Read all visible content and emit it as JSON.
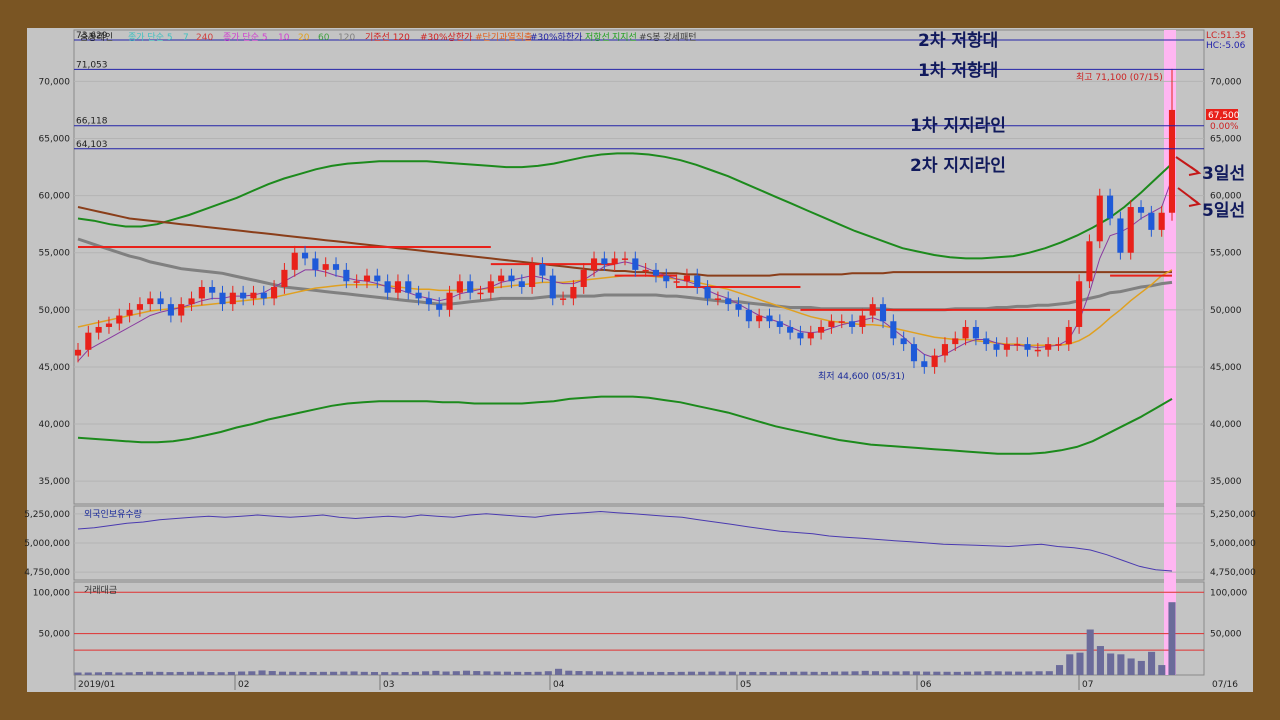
{
  "colors": {
    "background": "#c4c4c4",
    "frame": "#7a5523",
    "up_candle": "#e8211a",
    "down_candle": "#1f5ad8",
    "envelope": "#1c8a1c",
    "ma120": "#8a3e1a",
    "ma60": "#808080",
    "resistance_line": "#2323a8",
    "volume_bar": "#6b6b9a",
    "highlight": "#ffb6f2"
  },
  "header": {
    "title": "숨봉레인",
    "legend": [
      "종가 단순 5",
      "7",
      "240",
      "종가 단순 5",
      "10",
      "20",
      "60",
      "120",
      "기준선 120",
      "#30%상한가",
      "#단기과열직출",
      "#30%하한가",
      "저항선",
      "지지선",
      "#S봉 강세패턴"
    ],
    "lc": "LC:51.35",
    "hc": "HC:-5.06"
  },
  "annotations": {
    "res2": "2차 저항대",
    "res1": "1차 저항대",
    "sup1": "1차 지지라인",
    "sup2": "2차 지지라인",
    "ma3": "3일선",
    "ma5": "5일선"
  },
  "levels": [
    {
      "label": "73,629",
      "value": 73629
    },
    {
      "label": "71,053",
      "value": 71053
    },
    {
      "label": "66,118",
      "value": 66118
    },
    {
      "label": "64,103",
      "value": 64103
    }
  ],
  "markers": {
    "high": "최고 71,100 (07/15)",
    "low": "최저 44,600 (05/31)",
    "current_price": "67,500",
    "current_change": "0.00%"
  },
  "panels": {
    "foreign_label": "외국인보유수량",
    "volume_label": "거래대금"
  },
  "chart_data": {
    "type": "candlestick",
    "x_labels": [
      "2019/01",
      "02",
      "03",
      "04",
      "05",
      "06",
      "07",
      "07/16"
    ],
    "price_ylim": [
      33000,
      74500
    ],
    "price_ticks": [
      {
        "label": "70,000",
        "value": 70000
      },
      {
        "label": "65,000",
        "value": 65000
      },
      {
        "label": "60,000",
        "value": 60000
      },
      {
        "label": "55,000",
        "value": 55000
      },
      {
        "label": "50,000",
        "value": 50000
      },
      {
        "label": "45,000",
        "value": 45000
      },
      {
        "label": "40,000",
        "value": 40000
      },
      {
        "label": "35,000",
        "value": 35000
      }
    ],
    "right_price_ticks": [
      {
        "label": "70,000",
        "value": 70000
      },
      {
        "label": "65,000",
        "value": 65000
      },
      {
        "label": "60,000",
        "value": 60000
      },
      {
        "label": "55,000",
        "value": 55000
      },
      {
        "label": "50,000",
        "value": 50000
      },
      {
        "label": "45,000",
        "value": 45000
      },
      {
        "label": "40,000",
        "value": 40000
      },
      {
        "label": "35,000",
        "value": 35000
      }
    ],
    "close_path": [
      46500,
      48000,
      48500,
      48800,
      49500,
      50000,
      50500,
      51000,
      50500,
      49500,
      50500,
      51000,
      52000,
      51500,
      50500,
      51500,
      51000,
      51500,
      51000,
      52000,
      53500,
      55000,
      54500,
      53500,
      54000,
      53500,
      52500,
      52500,
      53000,
      52500,
      51500,
      52500,
      51500,
      51000,
      50500,
      50000,
      51500,
      52500,
      51500,
      51500,
      52500,
      53000,
      52500,
      52000,
      54000,
      53000,
      51000,
      51000,
      52000,
      53500,
      54500,
      54000,
      54500,
      54500,
      53500,
      53500,
      53000,
      52500,
      52500,
      53000,
      52000,
      51000,
      51000,
      50500,
      50000,
      49000,
      49500,
      49000,
      48500,
      48000,
      47500,
      48000,
      48500,
      49000,
      49000,
      48500,
      49500,
      50500,
      49000,
      47500,
      47000,
      45500,
      45000,
      46000,
      47000,
      47500,
      48500,
      47500,
      47000,
      46500,
      47000,
      47000,
      46500,
      46500,
      47000,
      47000,
      48500,
      52500,
      56000,
      60000,
      58000,
      55000,
      59000,
      58500,
      57000,
      58500,
      67500
    ],
    "ma5_path": [
      45500,
      46500,
      47000,
      47500,
      48000,
      48500,
      49000,
      49500,
      49800,
      50000,
      50200,
      50500,
      50800,
      51000,
      51000,
      51200,
      51200,
      51300,
      51500,
      52000,
      52500,
      53000,
      53500,
      53500,
      53300,
      53000,
      52800,
      52600,
      52500,
      52300,
      52000,
      51800,
      51500,
      51200,
      51000,
      50800,
      51000,
      51400,
      51600,
      51800,
      52000,
      52400,
      52600,
      52800,
      53000,
      52800,
      52500,
      52300,
      52300,
      52600,
      53200,
      53800,
      54000,
      54200,
      54000,
      53700,
      53300,
      53000,
      52700,
      52500,
      52200,
      51700,
      51300,
      51000,
      50500,
      50000,
      49500,
      49200,
      48900,
      48500,
      48100,
      48000,
      48100,
      48400,
      48700,
      48900,
      49100,
      49300,
      49000,
      48300,
      47600,
      46800,
      46100,
      45800,
      46100,
      46600,
      47100,
      47400,
      47400,
      47100,
      46900,
      46900,
      46800,
      46700,
      46800,
      46900,
      47400,
      49000,
      51500,
      54500,
      56500,
      56800,
      57300,
      58000,
      58500,
      59000,
      61500
    ],
    "ma20_path": [
      48500,
      48700,
      48900,
      49100,
      49300,
      49500,
      49700,
      49900,
      50000,
      50100,
      50200,
      50300,
      50400,
      50500,
      50600,
      50700,
      50800,
      50900,
      51000,
      51100,
      51300,
      51500,
      51700,
      51900,
      52000,
      52100,
      52200,
      52200,
      52200,
      52200,
      52100,
      52000,
      51900,
      51800,
      51800,
      51700,
      51700,
      51700,
      51800,
      51800,
      51900,
      52000,
      52100,
      52200,
      52300,
      52400,
      52400,
      52400,
      52500,
      52600,
      52700,
      52800,
      52900,
      53000,
      53000,
      53000,
      52900,
      52800,
      52700,
      52600,
      52400,
      52200,
      52000,
      51800,
      51500,
      51200,
      50900,
      50600,
      50300,
      50000,
      49700,
      49400,
      49200,
      49000,
      48900,
      48800,
      48700,
      48700,
      48600,
      48400,
      48200,
      48000,
      47800,
      47600,
      47500,
      47400,
      47400,
      47300,
      47200,
      47100,
      47000,
      47000,
      46900,
      46900,
      46900,
      46900,
      47000,
      47300,
      47800,
      48500,
      49300,
      50000,
      50800,
      51500,
      52200,
      53000,
      53500
    ],
    "ma60_path": [
      56200,
      55900,
      55600,
      55300,
      55000,
      54700,
      54500,
      54200,
      54000,
      53800,
      53600,
      53500,
      53400,
      53300,
      53200,
      53000,
      52800,
      52600,
      52400,
      52200,
      52000,
      51900,
      51800,
      51700,
      51600,
      51500,
      51400,
      51300,
      51200,
      51100,
      51000,
      50900,
      50800,
      50700,
      50600,
      50500,
      50500,
      50600,
      50700,
      50800,
      50900,
      51000,
      51000,
      51000,
      51000,
      51100,
      51200,
      51200,
      51200,
      51200,
      51200,
      51300,
      51300,
      51300,
      51300,
      51300,
      51300,
      51200,
      51200,
      51100,
      51000,
      50900,
      50800,
      50700,
      50700,
      50600,
      50500,
      50400,
      50300,
      50200,
      50200,
      50200,
      50100,
      50100,
      50100,
      50100,
      50100,
      50100,
      50100,
      50000,
      50000,
      50000,
      50000,
      50000,
      50000,
      50100,
      50100,
      50100,
      50100,
      50200,
      50200,
      50300,
      50300,
      50400,
      50400,
      50500,
      50600,
      50800,
      51000,
      51200,
      51500,
      51600,
      51800,
      52000,
      52100,
      52300,
      52400
    ],
    "ma120_path": [
      59000,
      58800,
      58600,
      58400,
      58200,
      58000,
      57900,
      57800,
      57700,
      57600,
      57500,
      57400,
      57300,
      57200,
      57100,
      57000,
      56900,
      56800,
      56700,
      56600,
      56500,
      56400,
      56300,
      56200,
      56100,
      56000,
      55900,
      55800,
      55700,
      55600,
      55500,
      55400,
      55300,
      55200,
      55100,
      55000,
      54900,
      54800,
      54700,
      54600,
      54500,
      54400,
      54300,
      54200,
      54100,
      54000,
      53900,
      53800,
      53700,
      53600,
      53500,
      53500,
      53400,
      53400,
      53300,
      53300,
      53200,
      53200,
      53200,
      53100,
      53100,
      53000,
      53000,
      53000,
      53000,
      53000,
      53000,
      53000,
      53100,
      53100,
      53100,
      53100,
      53100,
      53100,
      53100,
      53200,
      53200,
      53200,
      53200,
      53300,
      53300,
      53300,
      53300,
      53300,
      53300,
      53300,
      53300,
      53300,
      53300,
      53300,
      53300,
      53300,
      53300,
      53300,
      53300,
      53300,
      53300,
      53300,
      53300,
      53300,
      53300,
      53300,
      53300,
      53300,
      53300,
      53300,
      53300
    ],
    "upper_env": [
      58000,
      57800,
      57500,
      57300,
      57300,
      57500,
      57900,
      58300,
      58800,
      59300,
      59800,
      60400,
      61000,
      61500,
      61900,
      62300,
      62600,
      62800,
      62900,
      63000,
      63000,
      63000,
      63000,
      62900,
      62800,
      62700,
      62600,
      62500,
      62500,
      62600,
      62800,
      63100,
      63400,
      63600,
      63700,
      63700,
      63600,
      63400,
      63100,
      62700,
      62200,
      61700,
      61100,
      60500,
      59900,
      59300,
      58700,
      58100,
      57500,
      56900,
      56400,
      55900,
      55400,
      55100,
      54800,
      54600,
      54500,
      54500,
      54600,
      54700,
      55000,
      55400,
      55900,
      56500,
      57200,
      58000,
      59000,
      60200,
      61500,
      62800
    ],
    "lower_env": [
      38800,
      38700,
      38600,
      38500,
      38400,
      38400,
      38500,
      38700,
      39000,
      39300,
      39700,
      40000,
      40400,
      40700,
      41000,
      41300,
      41600,
      41800,
      41900,
      42000,
      42000,
      42000,
      42000,
      41900,
      41900,
      41800,
      41800,
      41800,
      41800,
      41900,
      42000,
      42200,
      42300,
      42400,
      42400,
      42400,
      42300,
      42100,
      41900,
      41600,
      41300,
      41000,
      40600,
      40200,
      39800,
      39500,
      39200,
      38900,
      38600,
      38400,
      38200,
      38100,
      38000,
      37900,
      37800,
      37700,
      37600,
      37500,
      37400,
      37400,
      37400,
      37500,
      37700,
      38000,
      38500,
      39200,
      39900,
      40600,
      41400,
      42200
    ],
    "support_line_steps": [
      {
        "from": 0,
        "to": 40,
        "value": 55500
      },
      {
        "from": 40,
        "to": 52,
        "value": 54000
      },
      {
        "from": 52,
        "to": 58,
        "value": 53000
      },
      {
        "from": 58,
        "to": 70,
        "value": 52000
      },
      {
        "from": 70,
        "to": 100,
        "value": 50000
      },
      {
        "from": 100,
        "to": 106,
        "value": 53000
      }
    ],
    "foreign_ylim": [
      4700000,
      5300000
    ],
    "foreign_ticks": [
      {
        "label": "5,250,000",
        "value": 5250000
      },
      {
        "label": "5,000,000",
        "value": 5000000
      },
      {
        "label": "4,750,000",
        "value": 4750000
      }
    ],
    "foreign_holdings": [
      5120000,
      5130000,
      5150000,
      5170000,
      5180000,
      5200000,
      5210000,
      5220000,
      5230000,
      5220000,
      5230000,
      5240000,
      5230000,
      5220000,
      5230000,
      5240000,
      5220000,
      5210000,
      5220000,
      5230000,
      5220000,
      5240000,
      5230000,
      5220000,
      5240000,
      5250000,
      5240000,
      5230000,
      5220000,
      5240000,
      5250000,
      5260000,
      5270000,
      5260000,
      5250000,
      5240000,
      5230000,
      5220000,
      5200000,
      5180000,
      5160000,
      5140000,
      5120000,
      5100000,
      5090000,
      5080000,
      5060000,
      5050000,
      5040000,
      5030000,
      5020000,
      5010000,
      5000000,
      4990000,
      4985000,
      4980000,
      4975000,
      4970000,
      4980000,
      4990000,
      4970000,
      4960000,
      4940000,
      4900000,
      4850000,
      4800000,
      4770000,
      4760000
    ],
    "volume_ylim": [
      0,
      110000
    ],
    "volume_ticks": [
      {
        "label": "100,000",
        "value": 100000
      },
      {
        "label": "50,000",
        "value": 50000
      }
    ],
    "volume_hlines": [
      100000,
      50000,
      30000
    ],
    "volume": [
      3000,
      3000,
      3200,
      3500,
      3000,
      3200,
      3600,
      4000,
      3800,
      3500,
      3700,
      3900,
      4000,
      3600,
      3400,
      3700,
      4200,
      4500,
      5500,
      4800,
      4000,
      3900,
      3700,
      3600,
      3800,
      3900,
      4100,
      4300,
      3800,
      3600,
      3500,
      3400,
      3600,
      3800,
      4500,
      5000,
      4200,
      4600,
      5200,
      4800,
      4400,
      4100,
      4000,
      3800,
      3700,
      3900,
      4600,
      7500,
      5200,
      4800,
      4600,
      4400,
      4200,
      4000,
      4100,
      3900,
      3800,
      3700,
      3600,
      3800,
      4000,
      3900,
      4100,
      4200,
      4000,
      3800,
      3700,
      3600,
      3700,
      3800,
      3900,
      4000,
      3800,
      3700,
      4100,
      4200,
      4500,
      5000,
      4600,
      4400,
      4200,
      4500,
      4300,
      4100,
      4000,
      3900,
      3800,
      4000,
      4200,
      4600,
      4400,
      4200,
      4100,
      4300,
      4500,
      4600,
      12000,
      25000,
      27000,
      55000,
      35000,
      26000,
      25000,
      20000,
      17000,
      28000,
      12000,
      88000
    ]
  }
}
